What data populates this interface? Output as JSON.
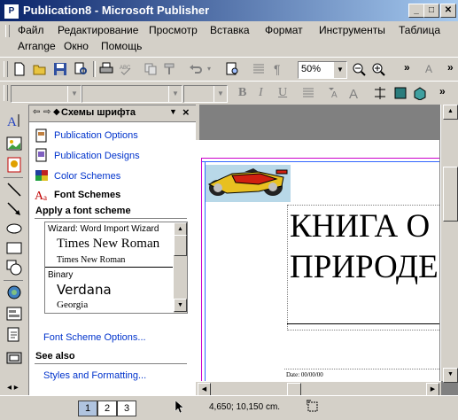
{
  "window": {
    "title": "Publication8 - Microsoft Publisher",
    "app_icon": "publisher-icon"
  },
  "menu": [
    "Файл",
    "Редактирование",
    "Просмотр",
    "Вставка",
    "Формат",
    "Инструменты",
    "Таблица",
    "Arrange",
    "Окно",
    "Помощь"
  ],
  "toolbar": {
    "zoom": "50%"
  },
  "formatting": {
    "bold": "B",
    "italic": "I",
    "underline": "U"
  },
  "taskpane": {
    "title": "Схемы шрифта",
    "links": [
      "Publication Options",
      "Publication Designs",
      "Color Schemes"
    ],
    "current": "Font Schemes",
    "apply_heading": "Apply a font scheme",
    "schemes": [
      {
        "name": "Wizard: Word Import Wizard",
        "heading": "Times New Roman",
        "body": "Times New Roman"
      },
      {
        "name": "Binary",
        "heading": "Verdana",
        "body": "Georgia"
      }
    ],
    "options_link": "Font Scheme Options...",
    "see_also": "See also",
    "styles_link": "Styles and Formatting..."
  },
  "document": {
    "title_line1": "КНИГА О",
    "title_line2": "ПРИРОДЕ",
    "date_label": "Date: 00/00/00"
  },
  "status": {
    "pages": [
      "1",
      "2",
      "3"
    ],
    "current_page": "1",
    "position": "4,650; 10,150 cm."
  },
  "colors": {
    "titlebar_start": "#0a246a",
    "titlebar_end": "#a6caf0",
    "link": "#0033cc",
    "guide_magenta": "#cc00cc",
    "guide_blue": "#3366ff"
  }
}
